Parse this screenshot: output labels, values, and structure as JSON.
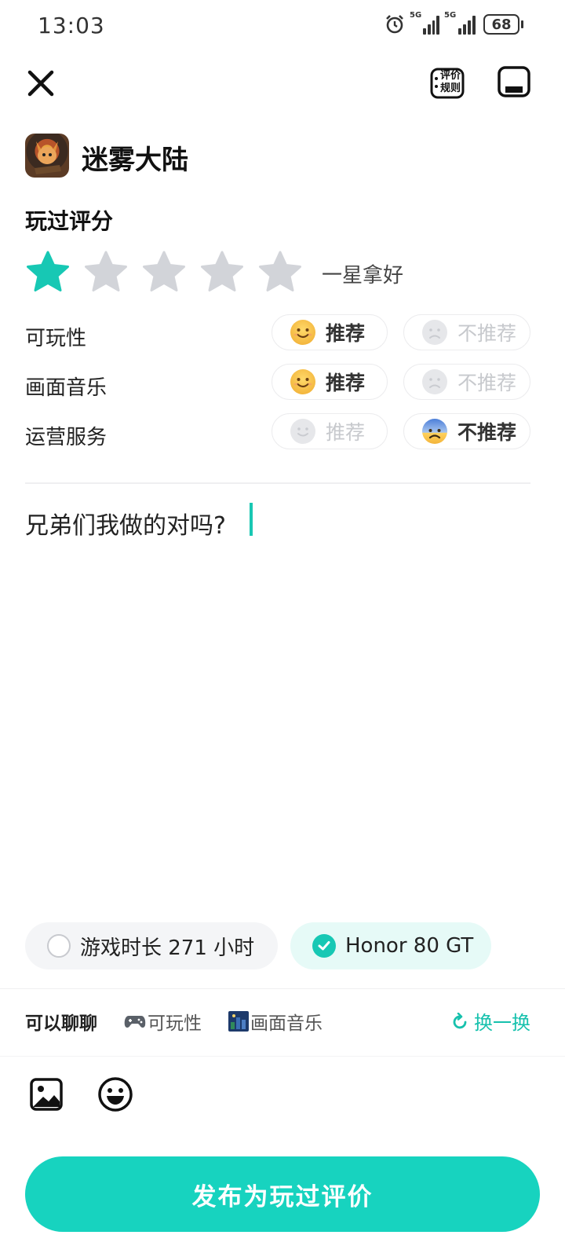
{
  "status_bar": {
    "time": "13:03",
    "signal_1_label": "5G",
    "signal_2_label": "5G",
    "battery": "68"
  },
  "header": {
    "rules_label_top": "评价",
    "rules_label_bottom": "规则"
  },
  "game": {
    "title": "迷雾大陆"
  },
  "rating": {
    "section_title": "玩过评分",
    "stars_selected": 1,
    "stars_total": 5,
    "text": "一星拿好",
    "active_color": "#17c8b4",
    "inactive_color": "#d2d4d9"
  },
  "aspects": [
    {
      "label": "可玩性",
      "recommend": "推荐",
      "not_recommend": "不推荐",
      "selected": "recommend"
    },
    {
      "label": "画面音乐",
      "recommend": "推荐",
      "not_recommend": "不推荐",
      "selected": "recommend"
    },
    {
      "label": "运营服务",
      "recommend": "推荐",
      "not_recommend": "不推荐",
      "selected": "not_recommend"
    }
  ],
  "review": {
    "text": "兄弟们我做的对吗?"
  },
  "chips": {
    "play_time": "游戏时长 271 小时",
    "device": "Honor 80 GT"
  },
  "topics": {
    "head": "可以聊聊",
    "items": [
      {
        "icon": "gamepad-icon",
        "label": "可玩性"
      },
      {
        "icon": "picture-icon",
        "label": "画面音乐"
      }
    ],
    "swap_label": "换一换"
  },
  "publish": {
    "label": "发布为玩过评价"
  },
  "colors": {
    "accent": "#17d3bf"
  }
}
